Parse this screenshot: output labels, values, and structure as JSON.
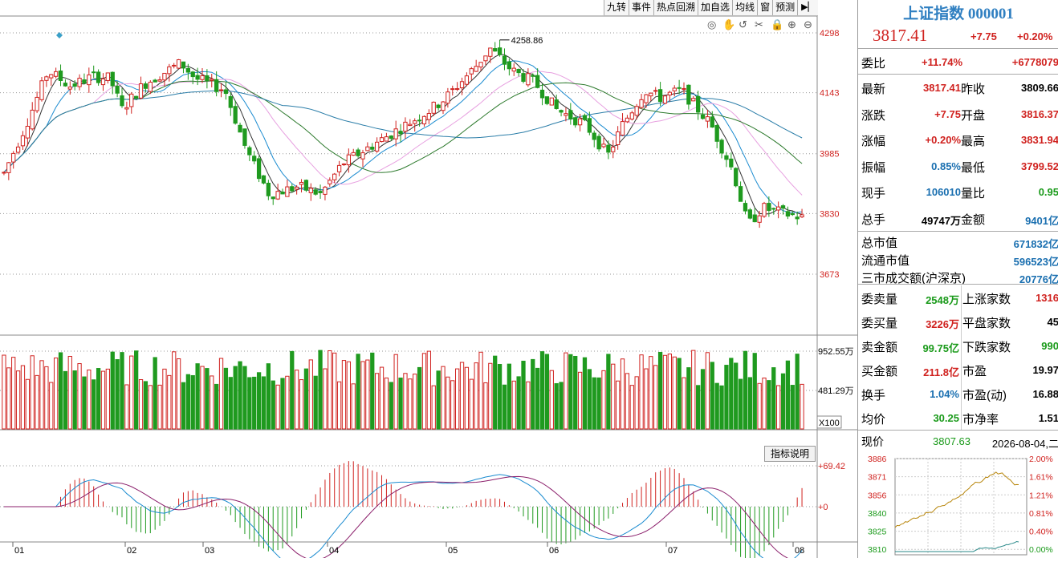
{
  "toolbar": {
    "items": [
      "九转",
      "事件",
      "热点回溯",
      "加自选",
      "均线",
      "窗",
      "预测"
    ],
    "end_icon": "play-end-icon"
  },
  "chart_icons": [
    "eye-icon",
    "hand-icon",
    "undo-icon",
    "scissors-icon",
    "lock-icon",
    "zoom-in-icon",
    "zoom-out-icon"
  ],
  "chart_data": [
    {
      "type": "candlestick",
      "title": "",
      "ylim": [
        3620,
        4340
      ],
      "y_ticks": [
        "4298",
        "4143",
        "3985",
        "3830",
        "3673"
      ],
      "x_ticks": [
        "01",
        "02",
        "03",
        "04",
        "05",
        "06",
        "07",
        "08"
      ],
      "annotations": [
        {
          "label": "4258.86"
        }
      ],
      "last_close": 3817.41,
      "grid": "dotted-horizontal"
    },
    {
      "type": "bar",
      "title": "volume",
      "y_ticks": [
        "952.55万",
        "481.29万"
      ],
      "unit_label": "X100"
    },
    {
      "type": "bar",
      "title": "MACD",
      "y_ticks": [
        "+69.42",
        "+0"
      ]
    }
  ],
  "indicator_help": "指标说明",
  "panel": {
    "title": "上证指数 000001",
    "price": "3817.41",
    "change": "+7.75",
    "change_pct": "+0.20%",
    "weibi_label": "委比",
    "weibi_pct": "+11.74%",
    "weibi_val": "+6778079",
    "rows": [
      {
        "l1": "最新",
        "v1": "3817.41",
        "c1": "red",
        "l2": "昨收",
        "v2": "3809.66",
        "c2": "black"
      },
      {
        "l1": "涨跌",
        "v1": "+7.75",
        "c1": "red",
        "l2": "开盘",
        "v2": "3816.37",
        "c2": "red"
      },
      {
        "l1": "涨幅",
        "v1": "+0.20%",
        "c1": "red",
        "l2": "最高",
        "v2": "3831.94",
        "c2": "red"
      },
      {
        "l1": "振幅",
        "v1": "0.85%",
        "c1": "blue",
        "l2": "最低",
        "v2": "3799.52",
        "c2": "red"
      },
      {
        "l1": "现手",
        "v1": "106010",
        "c1": "blue",
        "l2": "量比",
        "v2": "0.95",
        "c2": "green"
      },
      {
        "l1": "总手",
        "v1": "49747万",
        "c1": "black",
        "l2": "金额",
        "v2": "9401亿",
        "c2": "blue"
      }
    ],
    "mkt": [
      {
        "l": "总市值",
        "v": "671832亿"
      },
      {
        "l": "流通市值",
        "v": "596523亿"
      },
      {
        "l": "三市成交额(沪深京)",
        "v": "20776亿"
      }
    ],
    "rows2": [
      {
        "l1": "委卖量",
        "v1": "2548万",
        "c1": "green",
        "l2": "上涨家数",
        "v2": "1316",
        "c2": "red"
      },
      {
        "l1": "委买量",
        "v1": "3226万",
        "c1": "red",
        "l2": "平盘家数",
        "v2": "45",
        "c2": "black"
      },
      {
        "l1": "卖金额",
        "v1": "99.75亿",
        "c1": "green",
        "l2": "下跌家数",
        "v2": "990",
        "c2": "green"
      },
      {
        "l1": "买金额",
        "v1": "211.8亿",
        "c1": "red",
        "l2": "市盈",
        "v2": "19.97",
        "c2": "black"
      },
      {
        "l1": "换手",
        "v1": "1.04%",
        "c1": "blue",
        "l2": "市盈(动)",
        "v2": "16.88",
        "c2": "black"
      },
      {
        "l1": "均价",
        "v1": "30.25",
        "c1": "green",
        "l2": "市净率",
        "v2": "1.51",
        "c2": "black"
      }
    ],
    "now_label": "现价",
    "now_value": "3807.63",
    "date": "2026-08-04,二",
    "mini_left": [
      "3886",
      "3871",
      "3856",
      "3840",
      "3825",
      "3810"
    ],
    "mini_right": [
      "2.00%",
      "1.61%",
      "1.21%",
      "0.81%",
      "0.40%",
      "0.00%"
    ]
  }
}
